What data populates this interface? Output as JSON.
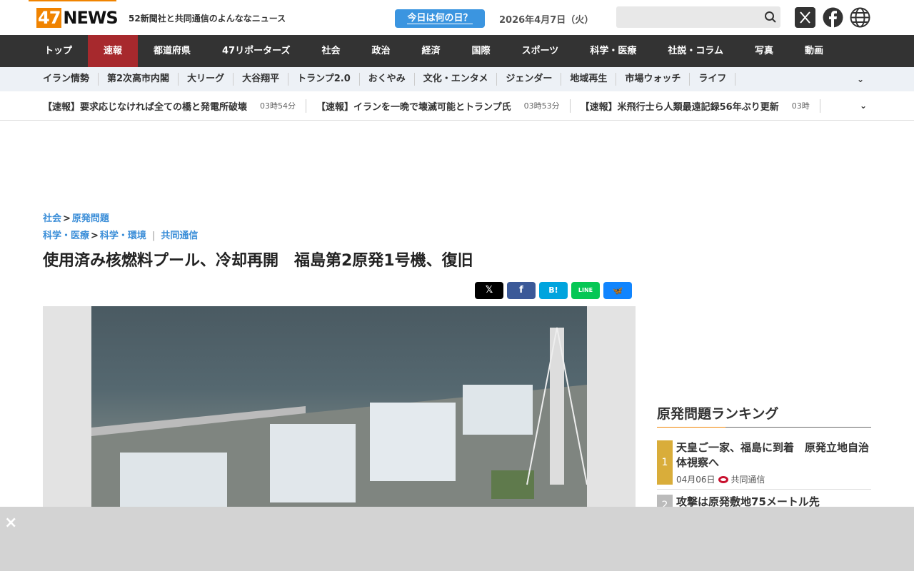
{
  "header": {
    "logo_num": "47",
    "logo_text": "NEWS",
    "tagline": "52新聞社と共同通信のよんななニュース",
    "today_button": "今日は何の日？",
    "date": "2026年4月7日（火）",
    "search_placeholder": ""
  },
  "nav": {
    "items": [
      "トップ",
      "速報",
      "都道府県",
      "47リポーターズ",
      "社会",
      "政治",
      "経済",
      "国際",
      "スポーツ",
      "科学・医療",
      "社説・コラム",
      "写真",
      "動画"
    ],
    "active": "速報"
  },
  "subnav": {
    "items": [
      "イラン情勢",
      "第2次高市内閣",
      "大リーグ",
      "大谷翔平",
      "トランプ2.0",
      "おくやみ",
      "文化・エンタメ",
      "ジェンダー",
      "地域再生",
      "市場ウォッチ",
      "ライフ"
    ]
  },
  "ticker": [
    {
      "title": "【速報】要求応じなければ全ての橋と発電所破壊",
      "time": "03時54分"
    },
    {
      "title": "【速報】イランを一晩で壊滅可能とトランプ氏",
      "time": "03時53分"
    },
    {
      "title": "【速報】米飛行士ら人類最遠記録56年ぶり更新",
      "time": "03時"
    }
  ],
  "article": {
    "crumb1": [
      "社会",
      "原発問題"
    ],
    "crumb2": [
      "科学・医療",
      "科学・環境"
    ],
    "source": "共同通信",
    "sep": ">",
    "bar": "|",
    "title": "使用済み核燃料プール、冷却再開　福島第2原発1号機、復旧"
  },
  "share": {
    "x": "𝕏",
    "facebook": "f",
    "hatena": "B!",
    "line": "LINE",
    "bluesky": "🦋"
  },
  "colors": {
    "brand": "#f08300",
    "active_nav": "#a7292d",
    "link": "#3b8ed8",
    "rank1": "#d9ad3a"
  },
  "ranking": {
    "title": "原発問題ランキング",
    "items": [
      {
        "rank": "1",
        "title": "天皇ご一家、福島に到着　原発立地自治体視察へ",
        "date": "04月06日",
        "source": "共同通信"
      },
      {
        "rank": "2",
        "title": "攻撃は原発敷地75メートル先"
      }
    ]
  },
  "overlay": {
    "close": "×"
  }
}
